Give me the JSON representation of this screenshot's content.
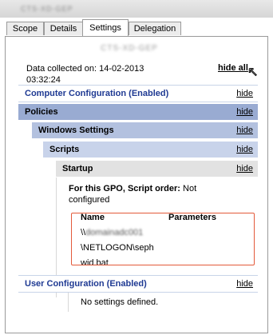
{
  "window": {
    "title_blurred": "CTS-XD-GEP"
  },
  "tabs": [
    {
      "label": "Scope",
      "active": false
    },
    {
      "label": "Details",
      "active": false
    },
    {
      "label": "Settings",
      "active": true
    },
    {
      "label": "Delegation",
      "active": false
    }
  ],
  "report": {
    "gpo_name_blurred": "CTS-XD-GEP",
    "collected_text": "Data collected on: 14-02-2013 03:32:24",
    "hide_all_label": "hide all",
    "computer_config": {
      "label": "Computer Configuration (Enabled)",
      "hide": "hide"
    },
    "policies": {
      "label": "Policies",
      "hide": "hide"
    },
    "windows_settings": {
      "label": "Windows Settings",
      "hide": "hide"
    },
    "scripts": {
      "label": "Scripts",
      "hide": "hide"
    },
    "startup": {
      "label": "Startup",
      "hide": "hide"
    },
    "script_order_label": "For this GPO, Script order:",
    "script_order_value": "Not configured",
    "table": {
      "col_name": "Name",
      "col_params": "Parameters",
      "path_prefix": "\\\\",
      "path_blurred": "domainadc001",
      "path_line2": "\\NETLOGON\\seph",
      "path_line3": "wid.bat"
    },
    "user_config": {
      "label": "User Configuration (Enabled)",
      "hide": "hide"
    },
    "no_settings": "No settings defined."
  },
  "colors": {
    "config_header_text": "#1f3a93",
    "highlight_box": "#e35a3a"
  }
}
